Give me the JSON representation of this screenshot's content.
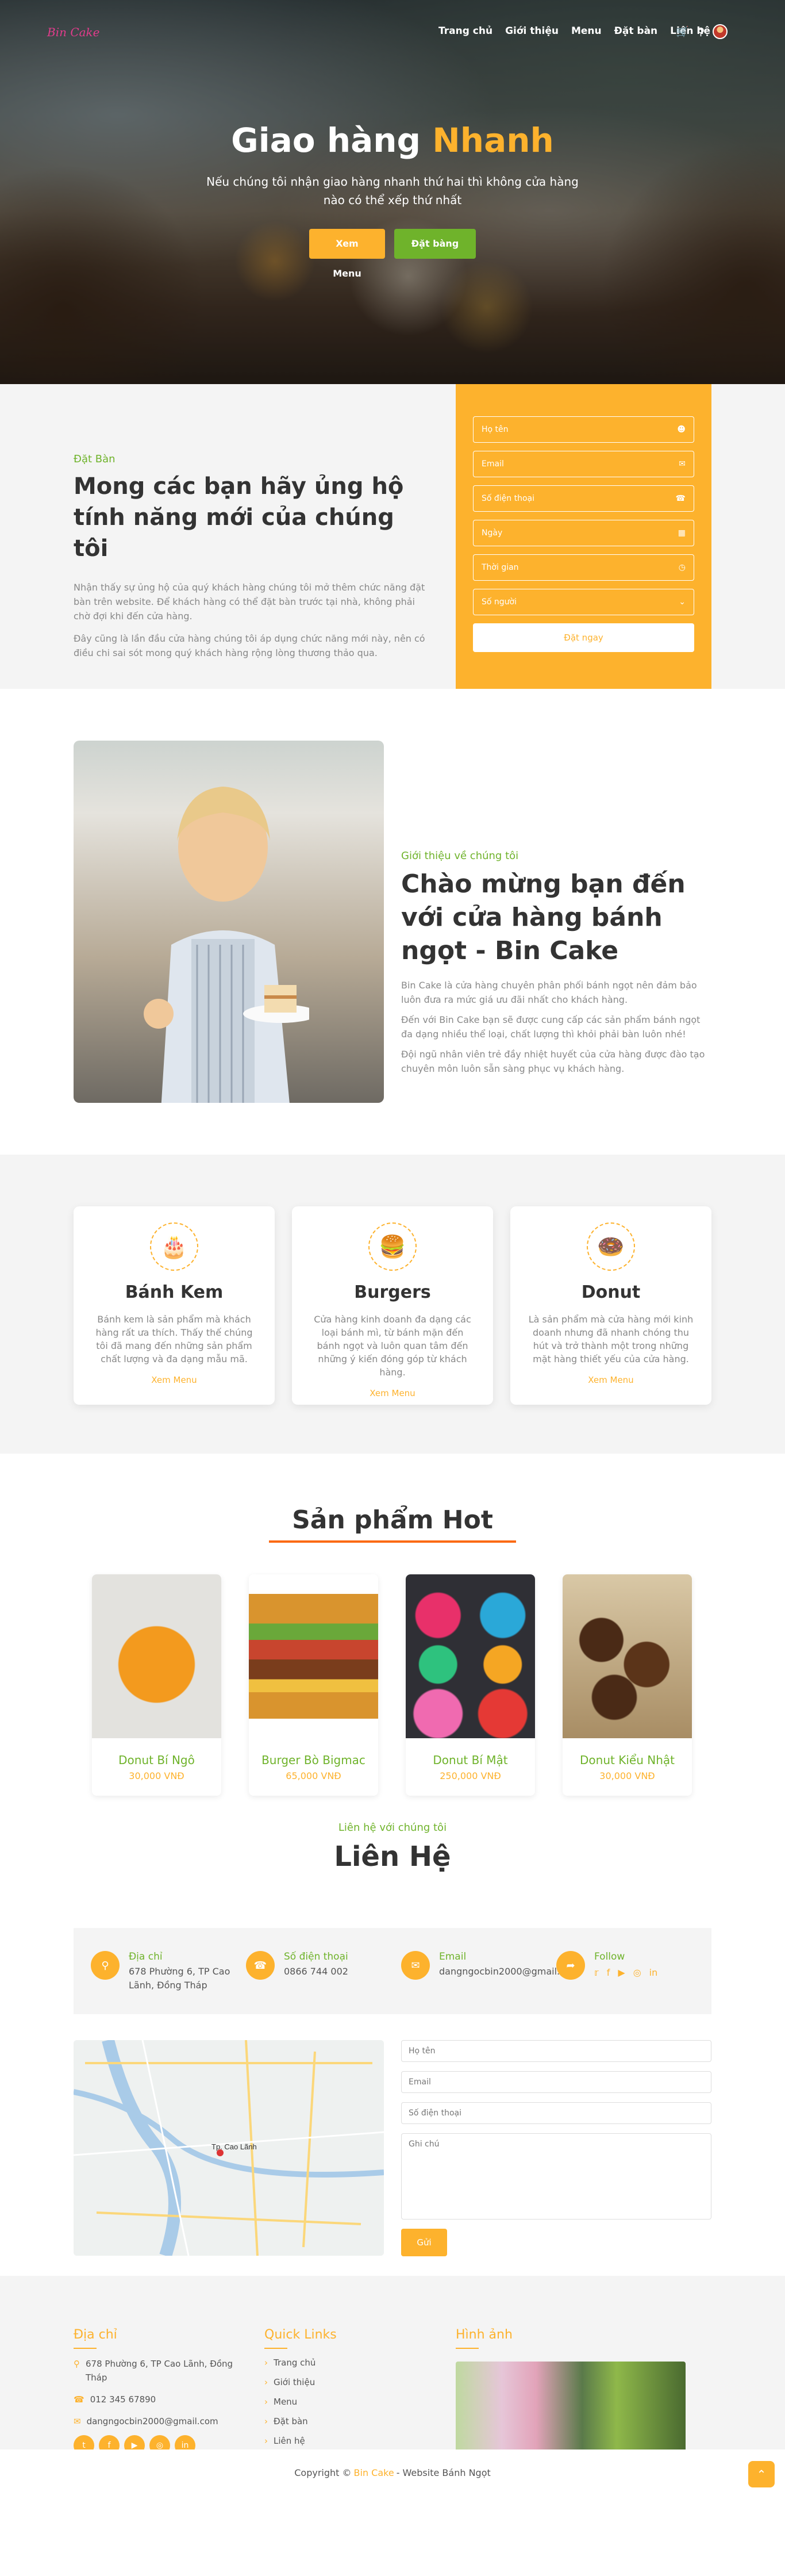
{
  "nav": {
    "logo": "Bin Cake",
    "items": [
      "Trang chủ",
      "Giới thiệu",
      "Menu",
      "Đặt bàn",
      "Liên hệ"
    ]
  },
  "hero": {
    "title_main": "Giao hàng ",
    "title_accent": "Nhanh",
    "subtitle": "Nếu chúng tôi nhận giao hàng nhanh thứ hai thì không cửa hàng nào có thể xếp thứ nhất",
    "btn_menu": "Xem Menu",
    "btn_book": "Đặt bàng"
  },
  "booking": {
    "kicker": "Đặt Bàn",
    "title": "Mong các bạn hãy ủng hộ tính năng mới của chúng tôi",
    "p1": "Nhận thấy sự ủng hộ của quý khách hàng chúng tôi mở thêm chức năng đặt bàn trên website. Để khách hàng có thể đặt bàn trước tại nhà, không phải chờ đợi khi đến cửa hàng.",
    "p2": "Đây cũng là lần đầu cửa hàng chúng tôi áp dụng chức năng mới này, nên có điều chi sai sót mong quý khách hàng rộng lòng thương thảo qua.",
    "fields": [
      "Họ tên",
      "Email",
      "Số điện thoại",
      "Ngày",
      "Thời gian",
      "Số người"
    ],
    "submit": "Đặt ngay"
  },
  "about": {
    "kicker": "Giới thiệu về chúng tôi",
    "title": "Chào mừng bạn đến với cửa hàng bánh ngọt - Bin Cake",
    "p1": "Bin Cake là cửa hàng chuyên phân phối bánh ngọt nên đảm bảo luôn đưa ra mức giá ưu đãi nhất cho khách hàng.",
    "p2": "Đến với Bin Cake bạn sẽ được cung cấp các sản phẩm bánh ngọt đa dạng nhiều thể loại, chất lượng thì khỏi phải bàn luôn nhé!",
    "p3": "Đội ngũ nhân viên trẻ đầy nhiệt huyết của cửa hàng được đào tạo chuyên môn luôn sẵn sàng phục vụ khách hàng."
  },
  "categories": [
    {
      "title": "Bánh Kem",
      "desc": "Bánh kem là sản phẩm mà khách hàng rất ưa thích. Thấy thế chúng tôi đã mang đến những sản phẩm chất lượng và đa dạng mẫu mã.",
      "link": "Xem Menu"
    },
    {
      "title": "Burgers",
      "desc": "Cửa hàng kinh doanh đa dạng các loại bánh mì, từ bánh mặn đến bánh ngọt và luôn quan tâm đến những ý kiến đóng góp từ khách hàng.",
      "link": "Xem Menu"
    },
    {
      "title": "Donut",
      "desc": "Là sản phẩm mà cửa hàng mới kinh doanh nhưng đã nhanh chóng thu hút và trở thành một trong những mặt hàng thiết yếu của cửa hàng.",
      "link": "Xem Menu"
    }
  ],
  "hot": {
    "title": "Sản phẩm Hot",
    "products": [
      {
        "name": "Donut Bí Ngô",
        "price": "30,000 VNĐ"
      },
      {
        "name": "Burger Bò Bigmac",
        "price": "65,000 VNĐ"
      },
      {
        "name": "Donut Bí Mật",
        "price": "250,000 VNĐ"
      },
      {
        "name": "Donut Kiểu Nhật",
        "price": "30,000 VNĐ"
      }
    ]
  },
  "contact": {
    "kicker": "Liên hệ với chúng tôi",
    "title": "Liên Hệ",
    "address_label": "Địa chỉ",
    "address": "678 Phường 6, TP Cao Lãnh, Đồng Tháp",
    "phone_label": "Số điện thoại",
    "phone": "0866 744 002",
    "email_label": "Email",
    "email": "dangngocbin2000@gmail.com",
    "follow_label": "Follow",
    "form": {
      "name": "Họ tên",
      "email": "Email",
      "phone": "Số điện thoại",
      "note": "Ghi chú",
      "send": "Gửi"
    },
    "map_label": "Tp. Cao Lãnh"
  },
  "footer": {
    "address_title": "Địa chỉ",
    "address": "678 Phường 6, TP Cao Lãnh, Đồng Tháp",
    "phone": "012 345 67890",
    "email": "dangngocbin2000@gmail.com",
    "links_title": "Quick Links",
    "links": [
      "Trang chủ",
      "Giới thiệu",
      "Menu",
      "Đặt bàn",
      "Liên hệ"
    ],
    "images_title": "Hình ảnh",
    "copy_prefix": "Copyright © ",
    "copy_brand": "Bin Cake",
    "copy_suffix": "- Website Bánh Ngọt"
  },
  "colors": {
    "accent": "#fdb22d",
    "green": "#6fb32b",
    "underline": "#fb6a14"
  }
}
